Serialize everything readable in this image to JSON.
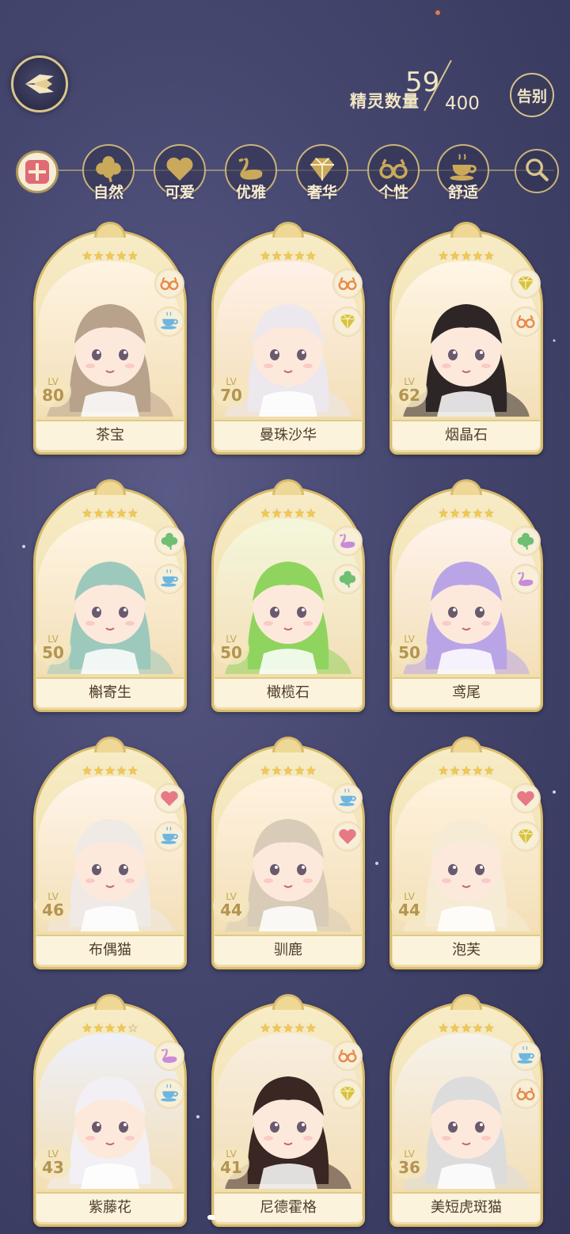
{
  "header": {
    "counter_label": "精灵数量",
    "counter_current": "59",
    "counter_total": "400",
    "farewell_label": "告别"
  },
  "filters": [
    {
      "key": "all",
      "label": "",
      "icon": "grid-icon"
    },
    {
      "key": "natural",
      "label": "自然",
      "icon": "clover-icon"
    },
    {
      "key": "cute",
      "label": "可爱",
      "icon": "heart-icon"
    },
    {
      "key": "elegant",
      "label": "优雅",
      "icon": "swan-icon"
    },
    {
      "key": "luxury",
      "label": "奢华",
      "icon": "diamond-icon"
    },
    {
      "key": "personality",
      "label": "个性",
      "icon": "glasses-icon"
    },
    {
      "key": "comfort",
      "label": "舒适",
      "icon": "teacup-icon"
    },
    {
      "key": "search",
      "label": "",
      "icon": "search-icon"
    }
  ],
  "colors": {
    "clover": "#6fbf73",
    "heart": "#e57a85",
    "swan": "#c98bd8",
    "diamond": "#d7c23c",
    "glasses": "#e7894a",
    "teacup": "#6cb6e0",
    "gold": "#d8bb6d"
  },
  "cards": [
    {
      "name": "茶宝",
      "lv_label": "LV",
      "level": "80",
      "stars": 5,
      "traits": [
        "glasses",
        "teacup"
      ],
      "hair": "#b8a28c",
      "bg": "#fff4e2"
    },
    {
      "name": "曼珠沙华",
      "lv_label": "LV",
      "level": "70",
      "stars": 5,
      "traits": [
        "glasses",
        "diamond"
      ],
      "hair": "#ece8ee",
      "bg": "#fff1e8"
    },
    {
      "name": "烟晶石",
      "lv_label": "LV",
      "level": "62",
      "stars": 5,
      "traits": [
        "diamond",
        "glasses"
      ],
      "hair": "#2e2626",
      "bg": "#fff6e6"
    },
    {
      "name": "槲寄生",
      "lv_label": "LV",
      "level": "50",
      "stars": 5,
      "traits": [
        "clover",
        "teacup"
      ],
      "hair": "#9cc9bc",
      "bg": "#fff5e3"
    },
    {
      "name": "橄榄石",
      "lv_label": "LV",
      "level": "50",
      "stars": 5,
      "traits": [
        "swan",
        "clover"
      ],
      "hair": "#8fd45e",
      "bg": "#f4f7dc"
    },
    {
      "name": "鸢尾",
      "lv_label": "LV",
      "level": "50",
      "stars": 5,
      "traits": [
        "clover",
        "swan"
      ],
      "hair": "#b9a5e6",
      "bg": "#fff3ec"
    },
    {
      "name": "布偶猫",
      "lv_label": "LV",
      "level": "46",
      "stars": 5,
      "traits": [
        "heart",
        "teacup"
      ],
      "hair": "#efeae6",
      "bg": "#fff5ea"
    },
    {
      "name": "驯鹿",
      "lv_label": "LV",
      "level": "44",
      "stars": 5,
      "traits": [
        "teacup",
        "heart"
      ],
      "hair": "#d8ccb8",
      "bg": "#fff2e0"
    },
    {
      "name": "泡芙",
      "lv_label": "LV",
      "level": "44",
      "stars": 5,
      "traits": [
        "heart",
        "diamond"
      ],
      "hair": "#f6ecd6",
      "bg": "#fff3df"
    },
    {
      "name": "紫藤花",
      "lv_label": "LV",
      "level": "43",
      "stars": 4,
      "traits": [
        "swan",
        "teacup"
      ],
      "hair": "#f2f0f4",
      "bg": "#eef0fa"
    },
    {
      "name": "尼德霍格",
      "lv_label": "LV",
      "level": "41",
      "stars": 5,
      "traits": [
        "glasses",
        "diamond"
      ],
      "hair": "#3a2622",
      "bg": "#f8eee0"
    },
    {
      "name": "美短虎斑猫",
      "lv_label": "LV",
      "level": "36",
      "stars": 5,
      "traits": [
        "teacup",
        "glasses"
      ],
      "hair": "#dcdcdc",
      "bg": "#f6f2ea"
    }
  ]
}
